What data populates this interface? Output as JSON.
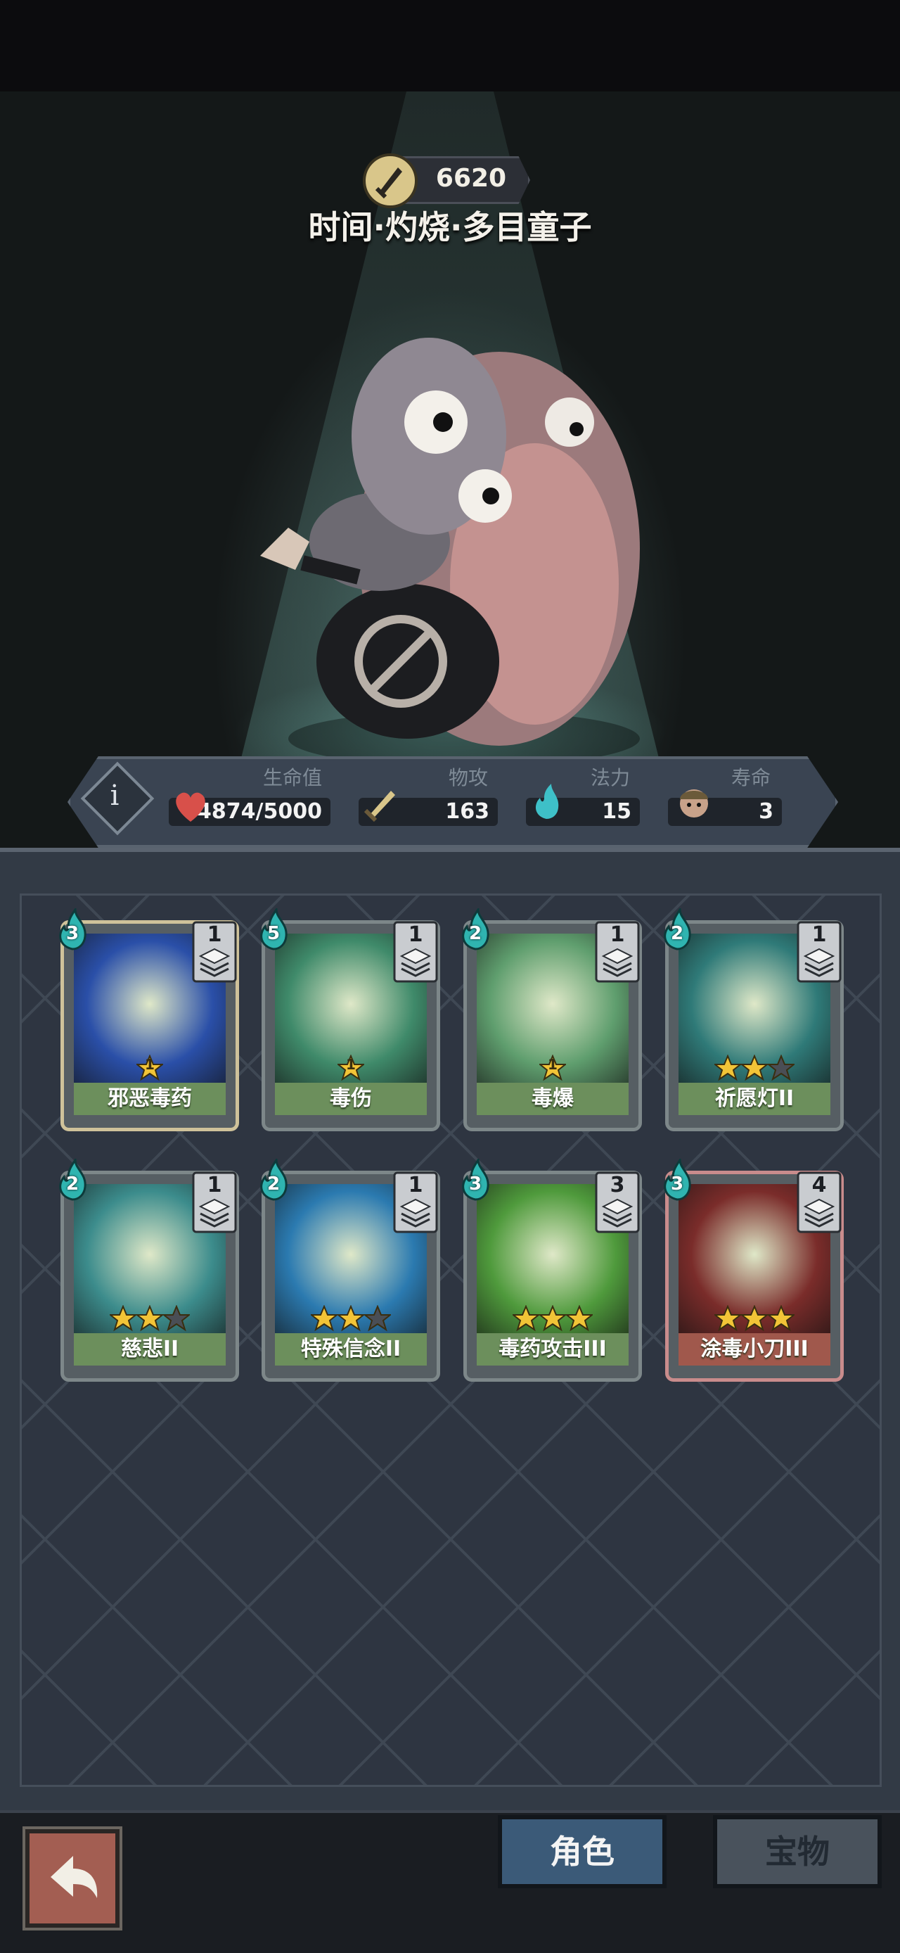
{
  "hero": {
    "power": "6620",
    "name": "时间·灼烧·多目童子"
  },
  "stats": {
    "hp_label": "生命值",
    "hp_value": "4874/5000",
    "atk_label": "物攻",
    "atk_value": "163",
    "mana_label": "法力",
    "mana_value": "15",
    "life_label": "寿命",
    "life_value": "3"
  },
  "cards": [
    {
      "name": "邪恶毒药",
      "cost": "3",
      "count": "1",
      "level": "1",
      "frame": "gold",
      "art": "#2a4fa8"
    },
    {
      "name": "毒伤",
      "cost": "5",
      "count": "1",
      "level": "1",
      "frame": "grey",
      "art": "#3f8a6a"
    },
    {
      "name": "毒爆",
      "cost": "2",
      "count": "1",
      "level": "1",
      "frame": "grey",
      "art": "#5f9e6e"
    },
    {
      "name": "祈愿灯II",
      "cost": "2",
      "count": "1",
      "stars_filled": 2,
      "stars_total": 3,
      "frame": "grey",
      "art": "#2f7a78"
    },
    {
      "name": "慈悲II",
      "cost": "2",
      "count": "1",
      "stars_filled": 2,
      "stars_total": 3,
      "frame": "grey",
      "art": "#3c8c8c"
    },
    {
      "name": "特殊信念II",
      "cost": "2",
      "count": "1",
      "stars_filled": 2,
      "stars_total": 3,
      "frame": "grey",
      "art": "#2b7ab0"
    },
    {
      "name": "毒药攻击III",
      "cost": "3",
      "count": "3",
      "stars_filled": 3,
      "stars_total": 3,
      "frame": "grey",
      "art": "#4f9a3c"
    },
    {
      "name": "涂毒小刀III",
      "cost": "3",
      "count": "4",
      "stars_filled": 3,
      "stars_total": 3,
      "frame": "red",
      "art": "#7a2c2a"
    }
  ],
  "tabs": {
    "role": "角色",
    "treasure": "宝物"
  },
  "colors": {
    "label_green": "#6c8f5c",
    "label_red": "#a0584c",
    "tab_active": "#3b5a78",
    "panel": "#323a45"
  },
  "icons": {
    "power": "sword-badge-icon",
    "hp": "heart-icon",
    "atk": "sword-icon",
    "mana": "flame-icon",
    "life": "face-icon",
    "back": "return-arrow-icon"
  }
}
